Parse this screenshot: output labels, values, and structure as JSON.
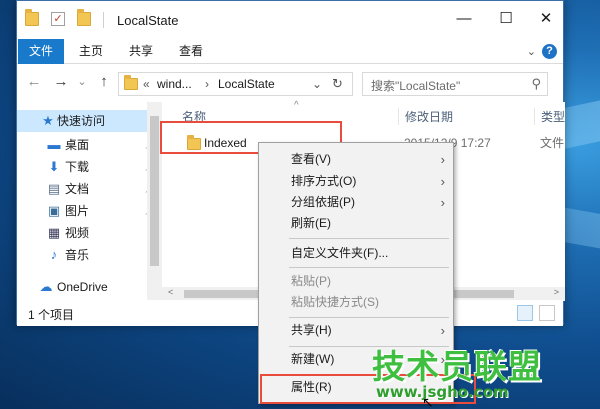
{
  "window": {
    "title": "LocalState",
    "minimize_glyph": "—",
    "maximize_glyph": "☐",
    "close_glyph": "✕"
  },
  "ribbon": {
    "tabs": [
      "文件",
      "主页",
      "共享",
      "查看"
    ],
    "active_tab": "文件",
    "expand_glyph": "⌄",
    "help_glyph": "?"
  },
  "navigation": {
    "back_glyph": "←",
    "forward_glyph": "→",
    "recent_glyph": "⌄",
    "up_glyph": "↑",
    "path_prefix": "«",
    "path_parent": "wind...",
    "path_sep": "›",
    "path_current": "LocalState",
    "dropdown_glyph": "⌄",
    "refresh_glyph": "↻",
    "search_placeholder": "搜索\"LocalState\"",
    "search_glyph": "⚲"
  },
  "nav_pane": {
    "items": [
      {
        "label": "快速访问",
        "icon": "star-icon",
        "selected": true,
        "pinned": false
      },
      {
        "label": "桌面",
        "icon": "desktop-icon",
        "selected": false,
        "pinned": true
      },
      {
        "label": "下载",
        "icon": "download-icon",
        "selected": false,
        "pinned": true
      },
      {
        "label": "文档",
        "icon": "document-icon",
        "selected": false,
        "pinned": true
      },
      {
        "label": "图片",
        "icon": "picture-icon",
        "selected": false,
        "pinned": true
      },
      {
        "label": "视频",
        "icon": "video-icon",
        "selected": false,
        "pinned": false
      },
      {
        "label": "音乐",
        "icon": "music-icon",
        "selected": false,
        "pinned": false
      },
      {
        "label": "OneDrive",
        "icon": "onedrive-icon",
        "selected": false,
        "pinned": false
      }
    ],
    "pin_glyph": "📌"
  },
  "file_list": {
    "columns": [
      "名称",
      "修改日期",
      "类型"
    ],
    "sort_glyph": "^",
    "rows": [
      {
        "name": "Indexed",
        "modified": "2015/12/9 17:27",
        "type": "文件"
      }
    ],
    "scroll_left_glyph": "<",
    "scroll_right_glyph": ">"
  },
  "status": {
    "item_count": "1 个项目"
  },
  "context_menu": {
    "items": [
      {
        "label": "查看(V)",
        "submenu": true,
        "disabled": false
      },
      {
        "label": "排序方式(O)",
        "submenu": true,
        "disabled": false
      },
      {
        "label": "分组依据(P)",
        "submenu": true,
        "disabled": false
      },
      {
        "label": "刷新(E)",
        "submenu": false,
        "disabled": false
      },
      {
        "label": "自定义文件夹(F)...",
        "submenu": false,
        "disabled": false
      },
      {
        "label": "粘贴(P)",
        "submenu": false,
        "disabled": true
      },
      {
        "label": "粘贴快捷方式(S)",
        "submenu": false,
        "disabled": true
      },
      {
        "label": "共享(H)",
        "submenu": true,
        "disabled": false
      },
      {
        "label": "新建(W)",
        "submenu": true,
        "disabled": false
      },
      {
        "label": "属性(R)",
        "submenu": false,
        "disabled": false
      }
    ],
    "submenu_glyph": "›"
  },
  "watermark": {
    "brand": "技术员联盟",
    "url": "www.jsgho.com"
  },
  "colors": {
    "accent": "#1979ca",
    "highlight_box": "#e74c3c",
    "watermark_green": "#3fbf3f"
  }
}
